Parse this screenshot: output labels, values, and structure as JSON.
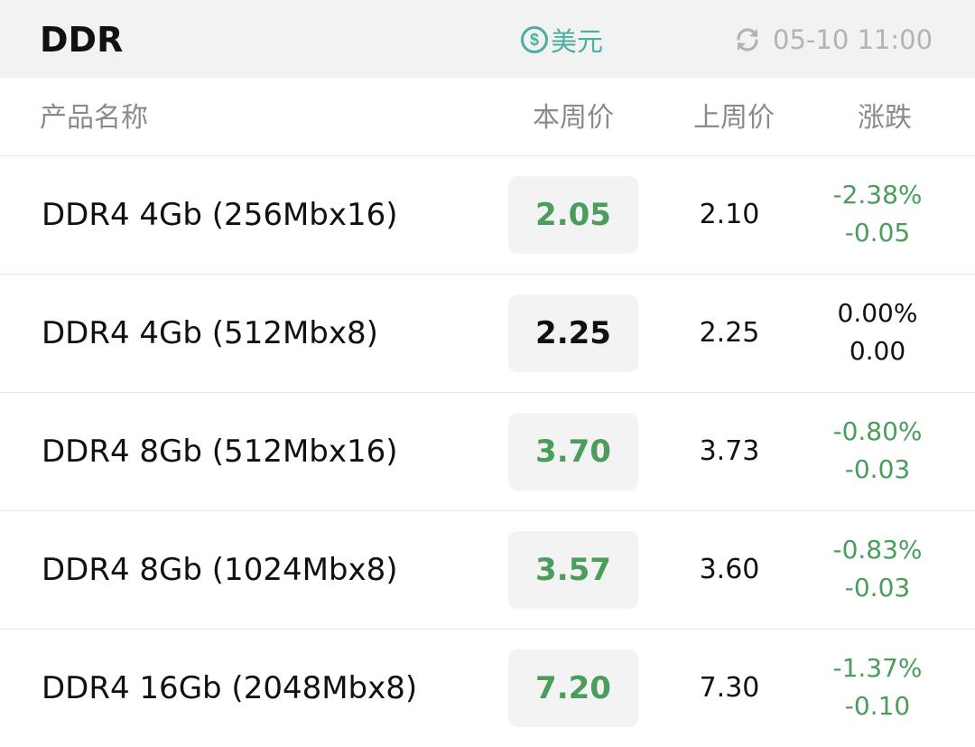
{
  "header": {
    "title": "DDR",
    "currency_label": "美元",
    "currency_icon": "dollar-circle-icon",
    "update_icon": "refresh-icon",
    "update_time": "05-10 11:00"
  },
  "columns": {
    "name": "产品名称",
    "this_week": "本周价",
    "last_week": "上周价",
    "change": "涨跌"
  },
  "colors": {
    "accent": "#4aaea0",
    "down": "#4a9d5a",
    "flat": "#111111"
  },
  "rows": [
    {
      "name": "DDR4 4Gb (256Mbx16)",
      "this_week": "2.05",
      "last_week": "2.10",
      "change_pct": "-2.38%",
      "change_abs": "-0.05",
      "trend": "down"
    },
    {
      "name": "DDR4 4Gb (512Mbx8)",
      "this_week": "2.25",
      "last_week": "2.25",
      "change_pct": "0.00%",
      "change_abs": "0.00",
      "trend": "flat"
    },
    {
      "name": "DDR4 8Gb (512Mbx16)",
      "this_week": "3.70",
      "last_week": "3.73",
      "change_pct": "-0.80%",
      "change_abs": "-0.03",
      "trend": "down"
    },
    {
      "name": "DDR4 8Gb (1024Mbx8)",
      "this_week": "3.57",
      "last_week": "3.60",
      "change_pct": "-0.83%",
      "change_abs": "-0.03",
      "trend": "down"
    },
    {
      "name": "DDR4 16Gb (2048Mbx8)",
      "this_week": "7.20",
      "last_week": "7.30",
      "change_pct": "-1.37%",
      "change_abs": "-0.10",
      "trend": "down"
    }
  ]
}
